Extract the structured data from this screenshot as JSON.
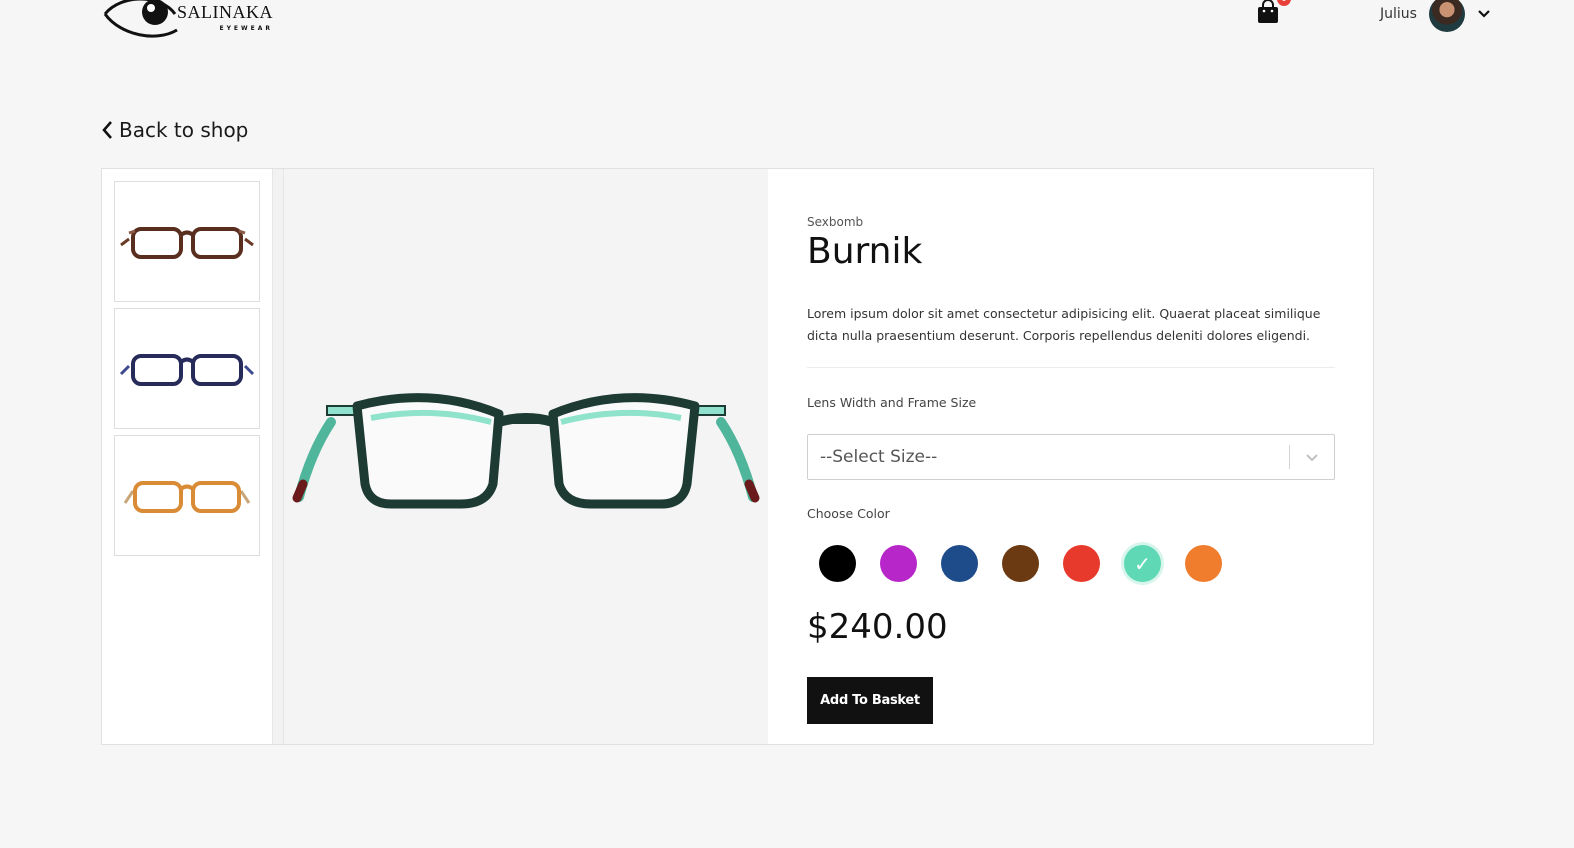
{
  "brand_logo": {
    "name": "SALINAKA",
    "sub": "EYEWEAR"
  },
  "header": {
    "cart_count": "0",
    "user_name": "Julius"
  },
  "back_link": {
    "label": "Back to shop"
  },
  "product": {
    "brand": "Sexbomb",
    "name": "Burnik",
    "description": "Lorem ipsum dolor sit amet consectetur adipisicing elit. Quaerat placeat similique dicta nulla praesentium deserunt. Corporis repellendus deleniti dolores eligendi.",
    "size_label": "Lens Width and Frame Size",
    "size_placeholder": "--Select Size--",
    "color_label": "Choose Color",
    "colors": [
      "#000000",
      "#b626c8",
      "#1e4c8a",
      "#6b3a12",
      "#e83a2c",
      "#5fd9b5",
      "#ef7d2d"
    ],
    "selected_color": "#5fd9b5",
    "price": "$240.00",
    "add_button": "Add To Basket"
  },
  "thumbnails": [
    {
      "color": "#6b3b28",
      "icon": "glasses-brown-icon"
    },
    {
      "color": "#2d3266",
      "icon": "glasses-navy-icon"
    },
    {
      "color": "#d79a4a",
      "icon": "glasses-amber-icon"
    }
  ],
  "main_image": {
    "frame_color": "#1d3a33",
    "temple_color": "#4fb59b",
    "tip_color": "#6a1a1a"
  }
}
